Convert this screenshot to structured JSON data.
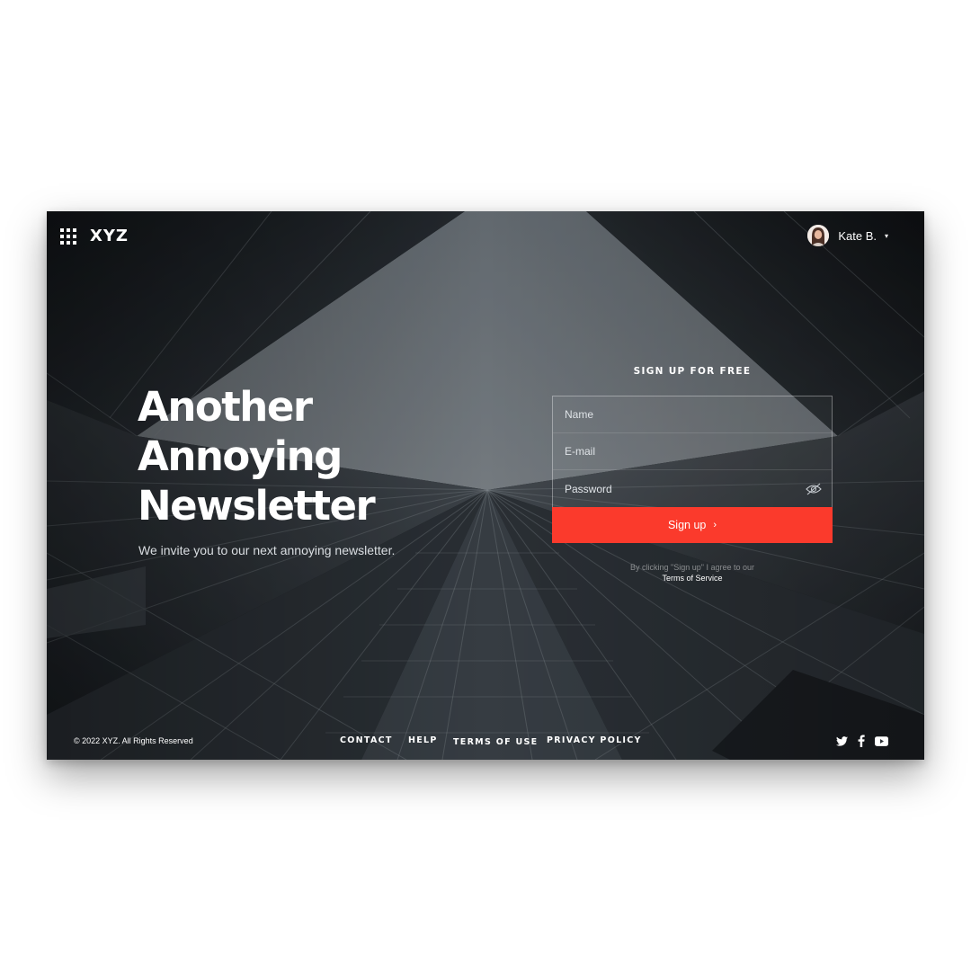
{
  "brand": {
    "logo": "XYZ"
  },
  "header": {
    "menu_icon": "grid-icon",
    "user_name": "Kate B.",
    "user_caret": "▾"
  },
  "hero": {
    "title_lines": [
      "Another",
      "Annoying",
      "Newsletter"
    ],
    "subtitle": "We invite you to our next annoying newsletter."
  },
  "form": {
    "title": "SIGN UP FOR FREE",
    "name_placeholder": "Name",
    "email_placeholder": "E-mail",
    "password_placeholder": "Password",
    "password_toggle_icon": "eye-off-icon",
    "submit_label": "Sign up",
    "submit_icon": "›",
    "terms_prefix": "By clicking \"Sign up\" I agree to our",
    "terms_link": "Terms of Service"
  },
  "footer": {
    "copyright": "© 2022 XYZ. All Rights Reserved",
    "links": [
      "CONTACT",
      "HELP",
      "TERMS OF USE",
      "PRIVACY POLICY"
    ],
    "social_icons": [
      "twitter-icon",
      "facebook-icon",
      "youtube-icon"
    ]
  },
  "colors": {
    "accent": "#fb3a2c",
    "text": "#ffffff",
    "page_background": "#ffffff"
  }
}
